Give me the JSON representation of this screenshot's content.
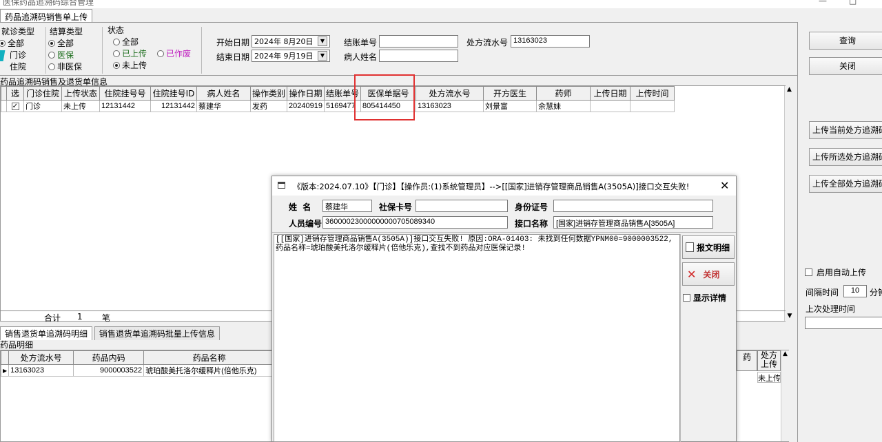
{
  "window": {
    "title": "医保药品追溯码综合管理",
    "min": "—",
    "max": "□"
  },
  "main_tab": "药品追溯码销售单上传",
  "filters": {
    "visit_type": {
      "title": "就诊类型",
      "options": [
        "全部",
        "门诊",
        "住院"
      ],
      "selected": 0
    },
    "settle_type": {
      "title": "结算类型",
      "options": [
        "全部",
        "医保",
        "非医保"
      ],
      "selected": 0
    },
    "status": {
      "title": "状态",
      "options": [
        "全部",
        "已上传",
        "已作废",
        "未上传"
      ],
      "selected": 3
    },
    "start_date_label": "开始日期",
    "start_date": "2024年 8月20日",
    "end_date_label": "结束日期",
    "end_date": "2024年 9月19日",
    "bill_no_label": "结账单号",
    "bill_no": "",
    "patient_label": "病人姓名",
    "patient": "",
    "rx_no_label": "处方流水号",
    "rx_no": "13163023"
  },
  "section_title": "药品追溯码销售及退货单信息",
  "grid": {
    "columns": [
      "选",
      "门诊住院",
      "上传状态",
      "住院挂号号",
      "住院挂号ID",
      "病人姓名",
      "操作类别",
      "操作日期",
      "结账单号",
      "医保单据号",
      "处方流水号",
      "开方医生",
      "药师",
      "上传日期",
      "上传时间"
    ],
    "rows": [
      {
        "check": "✓",
        "cells": [
          "门诊",
          "未上传",
          "12131442",
          "12131442",
          "蔡建华",
          "发药",
          "20240919",
          "5169477",
          "805414450",
          "13163023",
          "刘景富",
          "余慧妹",
          "",
          ""
        ]
      }
    ],
    "sum_label": "合计",
    "sum_count": "1",
    "sum_unit": "笔"
  },
  "right_panel": {
    "query": "查询",
    "close": "关闭",
    "upload_current": "上传当前处方追溯码",
    "upload_selected": "上传所选处方追溯码",
    "upload_all": "上传全部处方追溯码",
    "auto_upload": "启用自动上传",
    "interval_label": "间隔时间",
    "interval_value": "10",
    "interval_unit": "分钟",
    "last_time_label": "上次处理时间",
    "last_time_value": ""
  },
  "bottom_tabs": [
    "销售退货单追溯码明细",
    "销售退货单追溯码批量上传信息"
  ],
  "detail_title": "药品明细",
  "detail_grid": {
    "columns": [
      "处方流水号",
      "药品内码",
      "药品名称"
    ],
    "rows": [
      [
        "13163023",
        "9000003522",
        "琥珀酸美托洛尔缓释片(倍他乐克)"
      ]
    ],
    "right_cols": [
      "药",
      "处方"
    ],
    "right_col2_sub": "上传",
    "right_cell": "未上传"
  },
  "dialog": {
    "title": "《版本:2024.07.10》【门诊】【操作员:(1)系统管理员】-->[[国家]进销存管理商品销售A(3505A)]接口交互失败!",
    "name_label": "姓  名",
    "name": "蔡建华",
    "card_label": "社保卡号",
    "card": "",
    "id_label": "身份证号",
    "id": "",
    "psn_label": "人员编号",
    "psn": "36000023000000000705089340",
    "api_label": "接口名称",
    "api": "[国家]进销存管理商品销售A[3505A]",
    "message": "[[国家]进销存管理商品销售A(3505A)]接口交互失败! 原因:ORA-01403: 未找到任何数据YPNM00=9000003522,药品名称=琥珀酸美托洛尔缓释片(倍他乐克),查找不到药品对应医保记录!",
    "detail_btn": "报文明细",
    "close_btn": "关闭",
    "show_detail": "显示详情"
  },
  "colors": {
    "purple": "#c020c0",
    "green": "#207020",
    "teal": "#10b0c0",
    "red": "#e03030"
  }
}
